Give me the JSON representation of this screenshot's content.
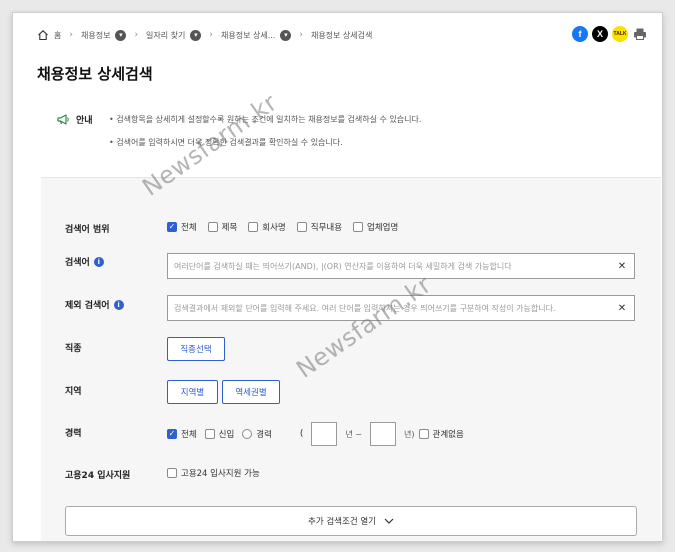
{
  "breadcrumb": {
    "home": "홈",
    "items": [
      "채용정보",
      "일자리 찾기",
      "채용정보 상세...",
      "채용정보 상세검색"
    ]
  },
  "share": {
    "facebook": "f",
    "x": "X",
    "kakao": "TALK",
    "print": "print-icon"
  },
  "page_title": "채용정보 상세검색",
  "notice": {
    "label": "안내",
    "lines": [
      "• 검색항목을 상세히게 설정할수록 원하는 조건에 일치하는 채용정보를 검색하실 수 있습니다.",
      "• 검색어를 입력하시면 더욱 정확한 검색결과를 확인하실 수 있습니다."
    ]
  },
  "watermark": "Newsfarm.kr",
  "search_scope": {
    "label": "검색어 범위",
    "options": [
      {
        "label": "전체",
        "checked": true
      },
      {
        "label": "제목",
        "checked": false
      },
      {
        "label": "회사명",
        "checked": false
      },
      {
        "label": "직무내용",
        "checked": false
      },
      {
        "label": "업체업명",
        "checked": false
      }
    ]
  },
  "keyword": {
    "label": "검색어",
    "placeholder": "여러단어를 검색하실 때는 띄어쓰기(AND), |(OR) 연산자를 이용하여 더욱 세밀하게 검색 가능합니다"
  },
  "exclude": {
    "label": "제외 검색어",
    "placeholder": "검색결과에서 제외할 단어를 입력해 주세요. 여러 단어를 입력하시는 경우 띄어쓰기를 구분하여 작성이 가능합니다."
  },
  "job_type": {
    "label": "직종",
    "button": "직종선택"
  },
  "region": {
    "label": "지역",
    "buttons": [
      "지역별",
      "역세권별"
    ]
  },
  "career": {
    "label": "경력",
    "options": [
      {
        "label": "전체",
        "type": "checkbox",
        "checked": true
      },
      {
        "label": "신입",
        "type": "checkbox",
        "checked": false
      },
      {
        "label": "경력",
        "type": "radio",
        "checked": false
      }
    ],
    "paren_open": "(",
    "year_from": "년 ~",
    "year_to": "년)",
    "no_matter": "관계없음"
  },
  "temp_support": {
    "label": "고용24 입사지원",
    "option": "고용24 입사지원 가능"
  },
  "more_button": "추가 검색조건 열기",
  "colors": {
    "accent": "#2f5fd0",
    "panel": "#f6f6f6"
  }
}
